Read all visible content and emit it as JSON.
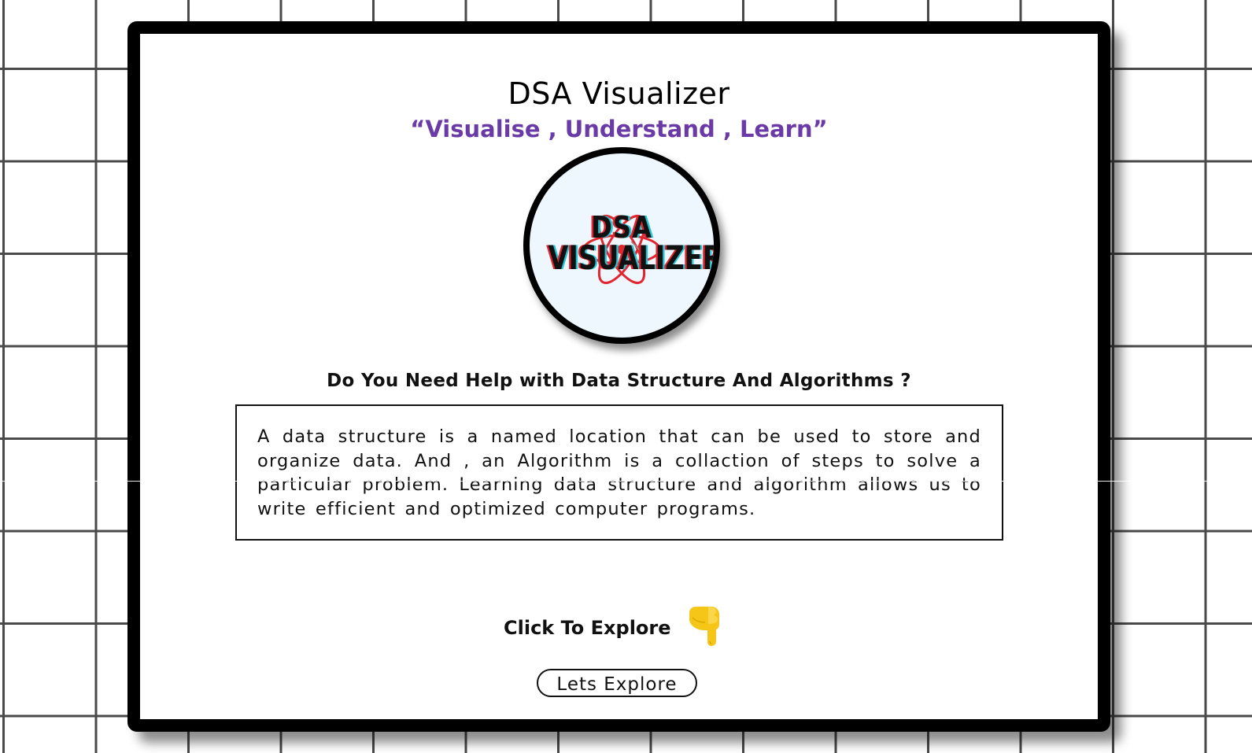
{
  "header": {
    "title": "DSA Visualizer",
    "tagline": "“Visualise , Understand , Learn”"
  },
  "logo": {
    "line1": "DSA",
    "line2": "VISUALIZER",
    "icon": "atom-icon"
  },
  "intro": {
    "question": "Do You Need Help with Data Structure And Algorithms ?",
    "description": "A data structure is a named location that can be used to store and organize data. And , an Algorithm is a collaction of steps to solve a particular problem. Learning data structure and algorithm allows us to write efficient and optimized computer programs."
  },
  "cta": {
    "prompt": "Click To Explore",
    "icon": "pointing-down-hand-icon",
    "button_label": "Lets Explore"
  },
  "colors": {
    "tagline": "#6a3ba6",
    "logo_background": "#eef7fe",
    "logo_red": "#e0262e",
    "logo_cyan": "#27c4d4",
    "hand_yellow": "#f5c518",
    "grid": "#4a4a4a"
  }
}
